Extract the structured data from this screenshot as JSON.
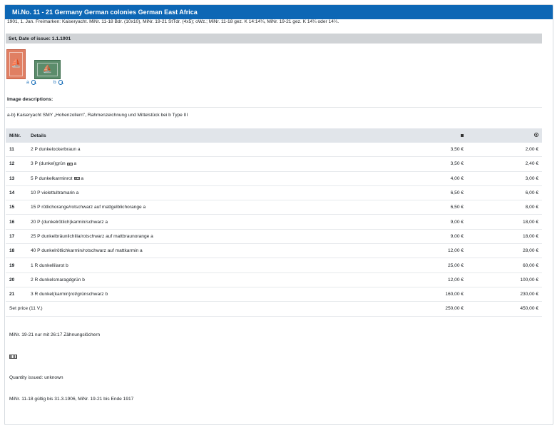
{
  "header": {
    "title": "Mi.No. 11 - 21  Germany German colonies German East Africa"
  },
  "intro": "1901, 1. Jan. Freimarken: Kaiseryacht. MiNr. 11-18 Bdr. (10x10), MiNr. 19-21 StTdr. (4x5); oWz.; MiNr. 11-18 gez. K 14:14¼, MiNr. 19-21 gez. K 14¼ oder 14¼.",
  "section": {
    "title": "Set, Date of issue: 1.1.1901"
  },
  "images": [
    {
      "label": "a",
      "icon": "zoom-icon"
    },
    {
      "label": "b",
      "icon": "zoom-icon"
    }
  ],
  "descriptions": {
    "heading": "Image descriptions:",
    "text": "a-b) Kaiseryacht SMY „Hohenzollern\", Rahmenzeichnung und Mittelstück bei b Type III"
  },
  "table": {
    "headers": {
      "minr": "MiNr.",
      "details": "Details"
    },
    "rows": [
      {
        "minr": "11",
        "details": "2 P dunkelockerbraun a",
        "mint": "3,50 €",
        "used": "2,00 €"
      },
      {
        "minr": "12",
        "details": "3 P (dunkel)grün",
        "badge": true,
        "suffix": "a",
        "mint": "3,50 €",
        "used": "2,40 €"
      },
      {
        "minr": "13",
        "details": "5 P dunkelkarminrot",
        "badge": true,
        "suffix": "a",
        "mint": "4,00 €",
        "used": "3,00 €"
      },
      {
        "minr": "14",
        "details": "10 P violettultramarin a",
        "mint": "6,50 €",
        "used": "6,00 €"
      },
      {
        "minr": "15",
        "details": "15 P rötlichorange/rotschwarz auf mattgelblichorange a",
        "mint": "6,50 €",
        "used": "8,00 €"
      },
      {
        "minr": "16",
        "details": "20 P (dunkelrötlich)karmin/schwarz a",
        "mint": "9,00 €",
        "used": "18,00 €"
      },
      {
        "minr": "17",
        "details": "25 P dunkelbräunlichlila/rotschwarz auf mattbraunorange a",
        "mint": "9,00 €",
        "used": "18,00 €"
      },
      {
        "minr": "18",
        "details": "40 P dunkelrötlichkarmin/rotschwarz auf mattkarmin a",
        "mint": "12,00 €",
        "used": "28,00 €"
      },
      {
        "minr": "19",
        "details": "1 R dunkellilarot b",
        "mint": "25,00 €",
        "used": "60,00 €"
      },
      {
        "minr": "20",
        "details": "2 R dunkelsmaragdgrün b",
        "mint": "12,00 €",
        "used": "100,00 €"
      },
      {
        "minr": "21",
        "details": "3 R dunkel(karmin)rot/grünschwarz b",
        "mint": "160,00 €",
        "used": "230,00 €"
      }
    ],
    "set_price": {
      "label": "Set price (11 V.)",
      "mint": "250,00 €",
      "used": "450,00 €"
    }
  },
  "notes": {
    "perforation": "MiNr. 19-21 nur mit 26:17 Zähnungslöchern",
    "quantity": "Quantity issued: unknown",
    "validity": "MiNr. 11-18 gültig bis 31.3.1906, MiNr. 19-21 bis Ende 1917"
  }
}
